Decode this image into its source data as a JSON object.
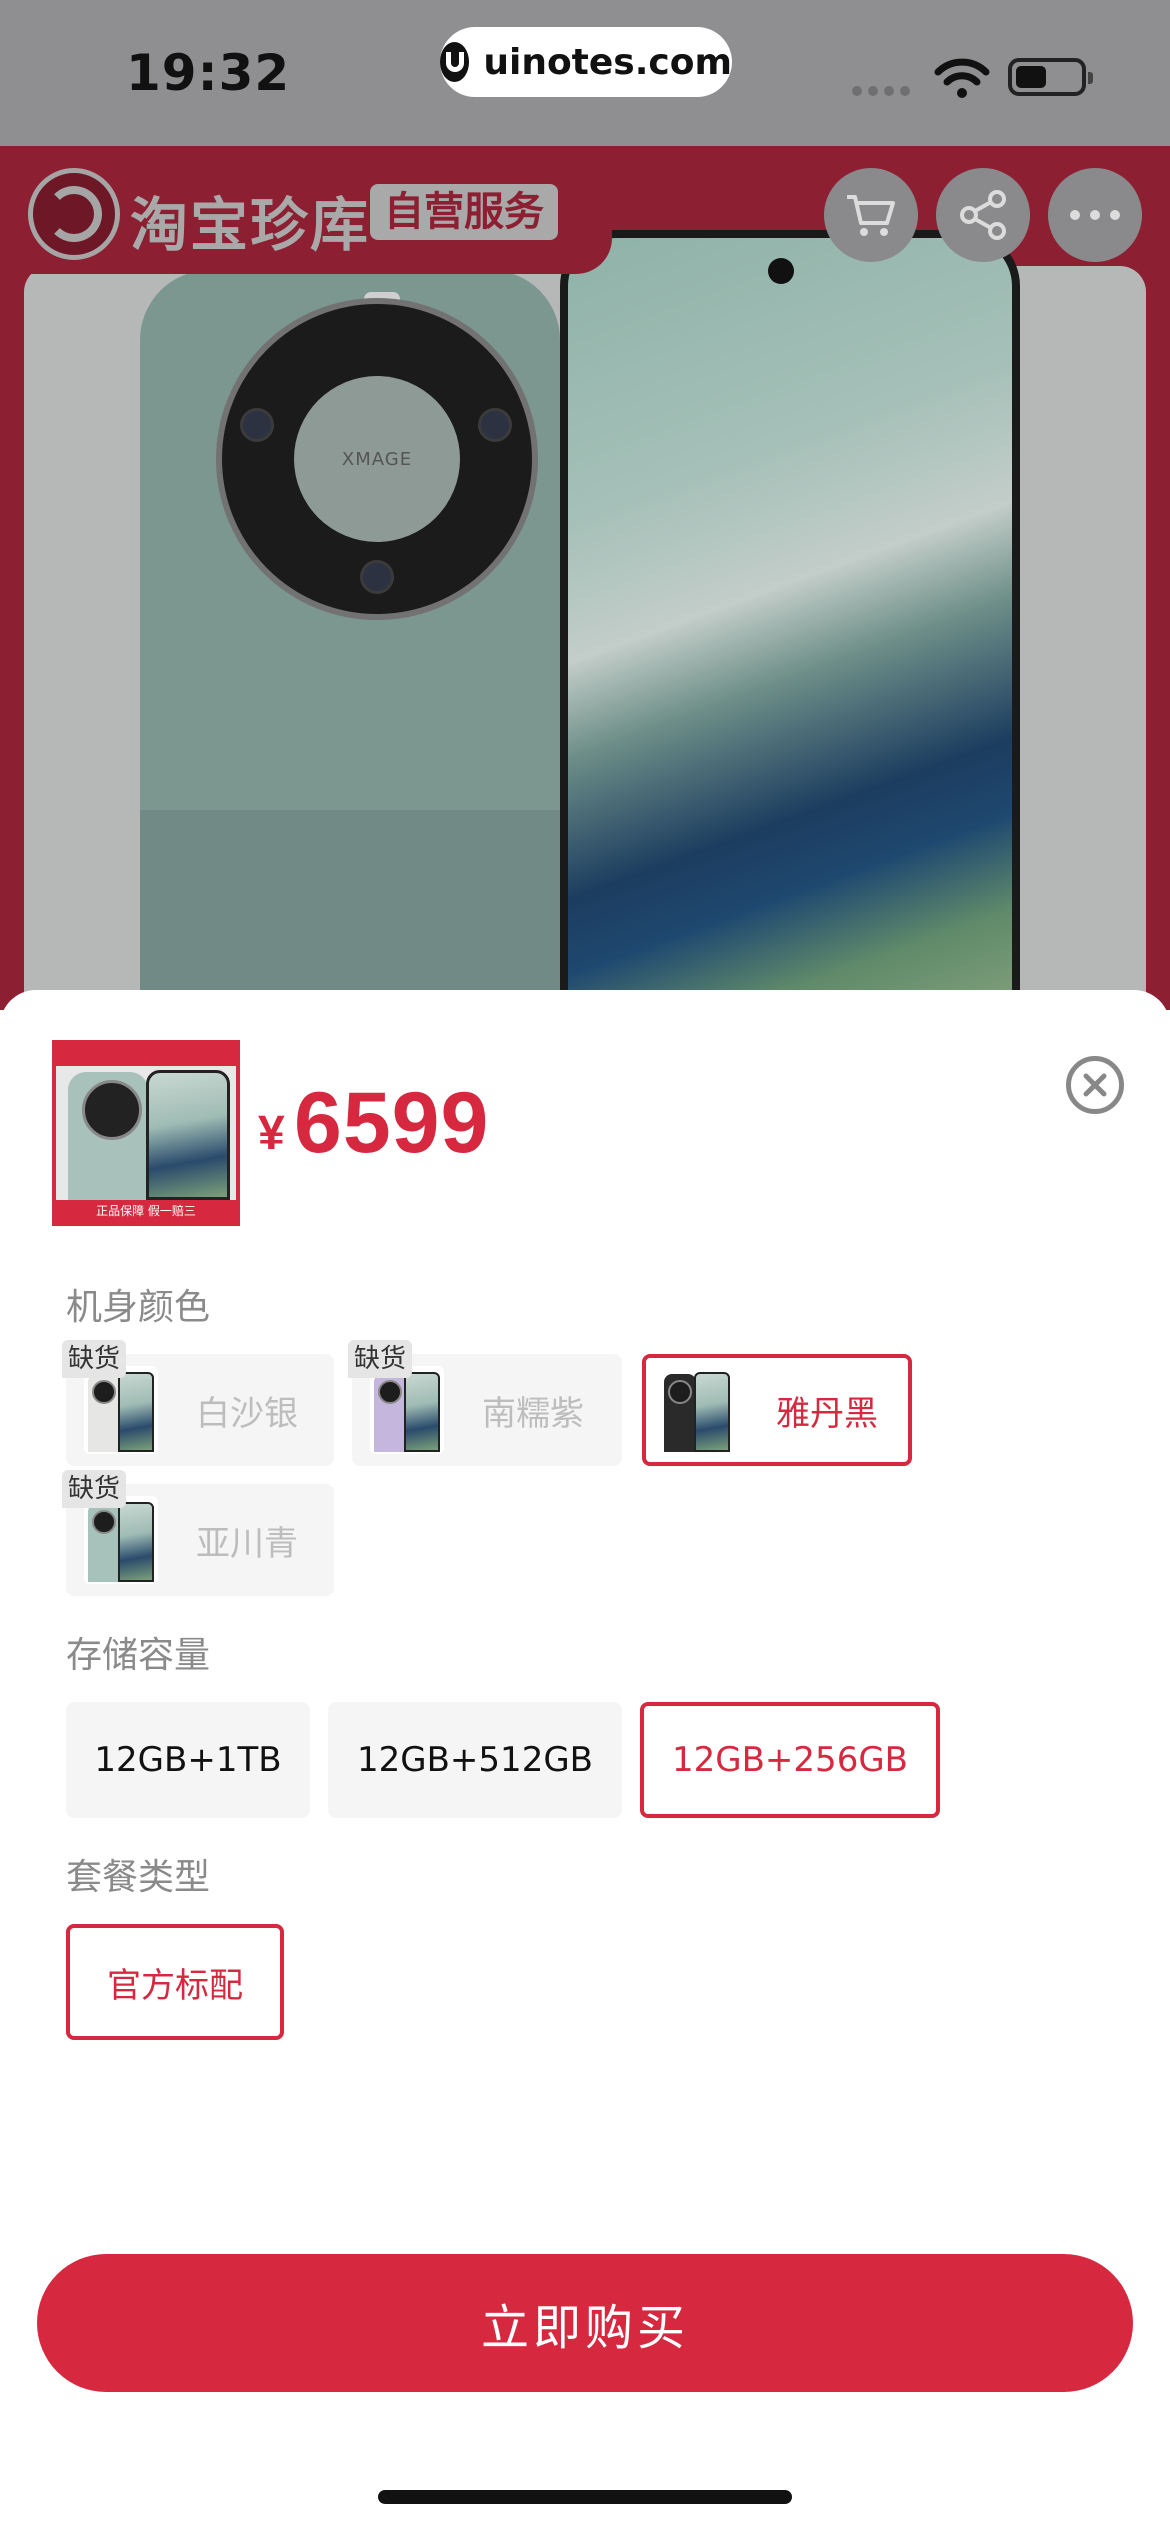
{
  "status_bar": {
    "time": "19:32",
    "url": "uinotes.com"
  },
  "product_banner": {
    "brand_name": "淘宝珍库",
    "brand_badge": "自营服务",
    "camera_text": "XMAGE",
    "actions": [
      "cart-icon",
      "share-icon",
      "more-icon"
    ]
  },
  "sheet": {
    "thumbnail_caption": "正品保障 假一赔三",
    "currency": "¥",
    "price": "6599",
    "close_icon": "close-icon",
    "color_section": {
      "title": "机身颜色",
      "options": [
        {
          "label": "白沙银",
          "state": "disabled",
          "badge": "缺货",
          "phone_color": "#e6e6e4"
        },
        {
          "label": "南糯紫",
          "state": "disabled",
          "badge": "缺货",
          "phone_color": "#c4b6dc"
        },
        {
          "label": "雅丹黑",
          "state": "selected",
          "badge": "",
          "phone_color": "#2a2a2a"
        },
        {
          "label": "亚川青",
          "state": "disabled",
          "badge": "缺货",
          "phone_color": "#a6c2bb"
        }
      ]
    },
    "storage_section": {
      "title": "存储容量",
      "options": [
        {
          "label": "12GB+1TB",
          "state": "normal"
        },
        {
          "label": "12GB+512GB",
          "state": "normal"
        },
        {
          "label": "12GB+256GB",
          "state": "selected"
        }
      ]
    },
    "package_section": {
      "title": "套餐类型",
      "options": [
        {
          "label": "官方标配",
          "state": "selected"
        }
      ]
    },
    "buy_button": "立即购买"
  },
  "colors": {
    "accent": "#d6283f",
    "disabled_text": "#bdbdbd"
  }
}
